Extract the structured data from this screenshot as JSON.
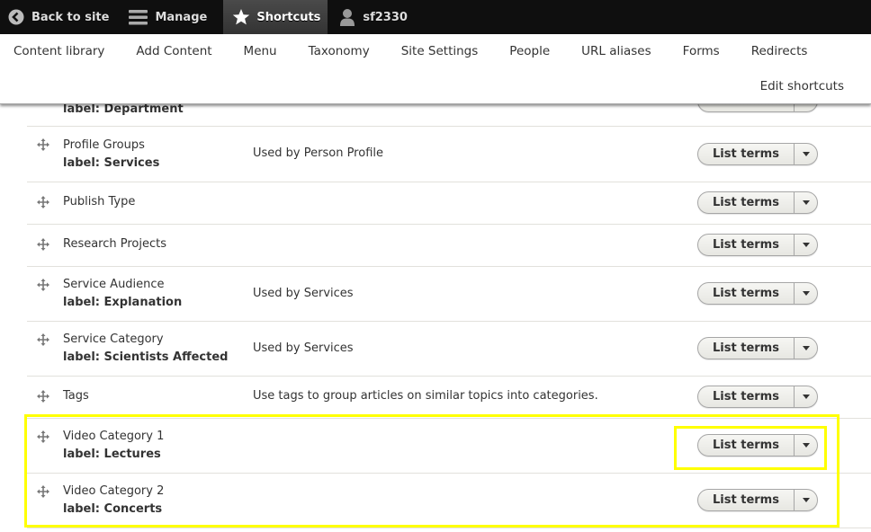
{
  "toolbar": {
    "back_label": "Back to site",
    "manage_label": "Manage",
    "shortcuts_label": "Shortcuts",
    "user_label": "sf2330"
  },
  "tray": {
    "links": [
      "Content library",
      "Add Content",
      "Menu",
      "Taxonomy",
      "Site Settings",
      "People",
      "URL aliases",
      "Forms",
      "Redirects"
    ],
    "edit_label": "Edit shortcuts"
  },
  "vocabularies": [
    {
      "name": "",
      "label": "label: Department",
      "description": "",
      "action": "List terms"
    },
    {
      "name": "Profile Groups",
      "label": "label: Services",
      "description": "Used by Person Profile",
      "action": "List terms"
    },
    {
      "name": "Publish Type",
      "label": "",
      "description": "",
      "action": "List terms"
    },
    {
      "name": "Research Projects",
      "label": "",
      "description": "",
      "action": "List terms"
    },
    {
      "name": "Service Audience",
      "label": "label: Explanation",
      "description": "Used by Services",
      "action": "List terms"
    },
    {
      "name": "Service Category",
      "label": "label: Scientists Affected",
      "description": "Used by Services",
      "action": "List terms"
    },
    {
      "name": "Tags",
      "label": "",
      "description": "Use tags to group articles on similar topics into categories.",
      "action": "List terms"
    },
    {
      "name": "Video Category 1",
      "label": "label: Lectures",
      "description": "",
      "action": "List terms"
    },
    {
      "name": "Video Category 2",
      "label": "label: Concerts",
      "description": "",
      "action": "List terms"
    }
  ],
  "highlight_color": "#ffff00"
}
